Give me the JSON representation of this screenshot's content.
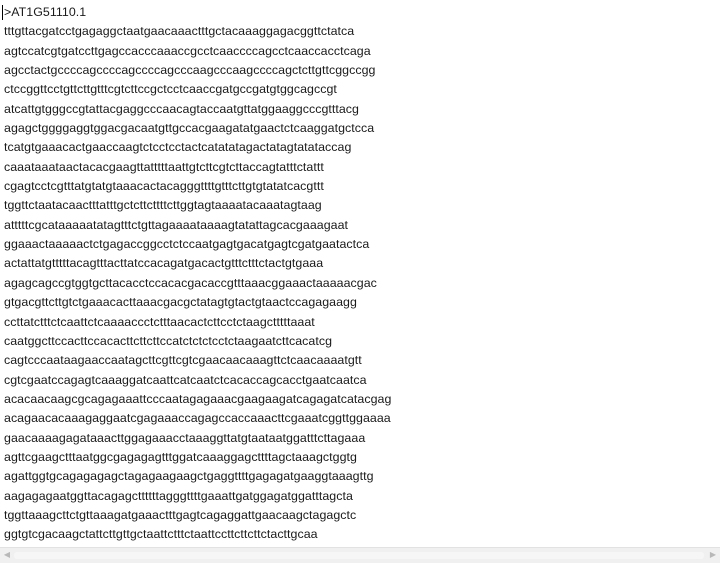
{
  "editor": {
    "lines": [
      ">AT1G51110.1",
      "tttgttacgatcctgagaggctaatgaacaaactttgctacaaaggagacggttctatca",
      "agtccatcgtgatccttgagccacccaaaccgcctcaaccccagcctcaaccacctcaga",
      "agcctactgccccagccccagccccagcccaagcccaagccccagctcttgttcggccgg",
      "ctccggttcctgttcttgtttcgtcttccgctcctcaaccgatgccgatgtggcagccgt",
      "atcattgtgggccgtattacgaggcccaacagtaccaatgttatggaaggcccgtttacg",
      "agagctggggaggtggacgacaatgttgccacgaagatatgaactctcaaggatgctcca",
      "tcatgtgaaacactgaaccaagtctcctcctactcatatatagactatagtatataccag",
      "caaataaataactacacgaagttatttttaattgtcttcgtcttaccagtatttctattt",
      "cgagtcctcgtttatgtatgtaaacactacagggttttgtttcttgtgtatatcacgttt",
      "tggttctaatacaactttatttgctcttcttttcttggtagtaaaatacaaatagtaag",
      "atttttcgcataaaaatatagtttctgttagaaaataaaagtatattagcacgaaagaat",
      "ggaaactaaaaactctgagaccggcctctccaatgagtgacatgagtcgatgaatactca",
      "actattatgtttttacagtttacttatccacagatgacactgtttctttctactgtgaaa",
      "agagcagccgtggtgcttacacctccacacgacaccgtttaaacggaaactaaaaacgac",
      "gtgacgttcttgtctgaaacacttaaacgacgctatagtgtactgtaactccagagaagg",
      "ccttatctttctcaattctcaaaaccctctttaacactcttcctctaagctttttaaat",
      "caatggcttccacttccacacttcttcttccatctctctcctctaagaatcttcacatcg",
      "cagtcccaataagaaccaatagcttcgttcgtcgaacaacaaagttctcaacaaaatgtt",
      "cgtcgaatccagagtcaaaggatcaattcatcaatctcacaccagcacctgaatcaatca",
      "acacaacaagcgcagagaaattcccaatagagaaacgaagaagatcagagatcatacgag",
      "acagaacacaaagaggaatcgagaaaccagagccaccaaacttcgaaatcggttggaaaa",
      "gaacaaaagagataaacttggagaaacctaaaggttatgtaataatggatttcttagaaa",
      "agttcgaagctttaatggcgagagagtttggatcaaaggagcttttagctaaagctggtg",
      "agattggtgcagagagagctagagaagaagctgaggttttgagagatgaaggtaaagttg",
      "aagagagaatggttacagagcttttttagggttttgaaattgatggagatggatttagcta",
      "tggttaaagcttctgttaaagatgaaactttgagtcagaggattgaacaagctagagctc",
      "ggtgtcgacaagctattcttgttgctaattctttctaattccttcttcttctacttgcaa",
      "attgagtcaaaagtctatgaattttgtttatagttttacacaaaacagagcttcttcatc"
    ]
  }
}
